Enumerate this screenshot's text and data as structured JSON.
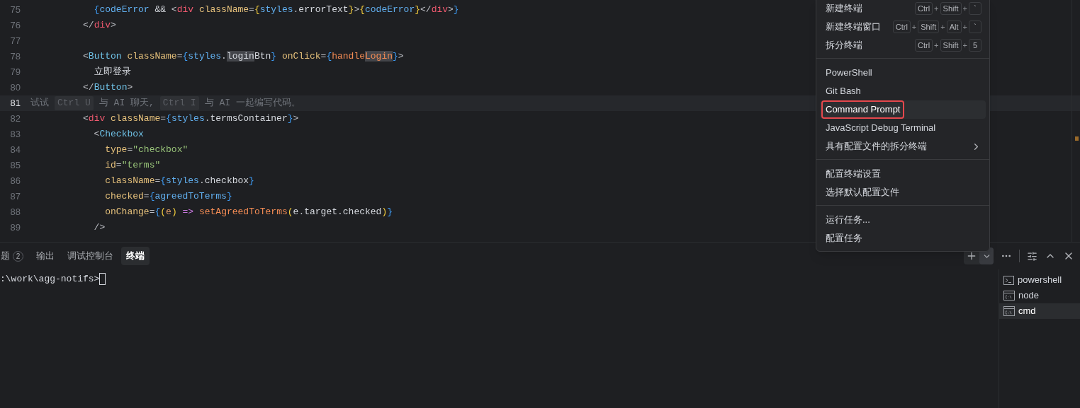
{
  "editor": {
    "lines": [
      {
        "number": "75",
        "current": false,
        "kind": "code",
        "tokens": [
          {
            "kind": "brace",
            "text": "            {"
          },
          {
            "kind": "var",
            "text": "codeError"
          },
          {
            "kind": "text",
            "text": " && "
          },
          {
            "kind": "punct",
            "text": "<"
          },
          {
            "kind": "tag",
            "text": "div"
          },
          {
            "kind": "attr",
            "text": " className"
          },
          {
            "kind": "punct",
            "text": "="
          },
          {
            "kind": "brace2",
            "text": "{"
          },
          {
            "kind": "var",
            "text": "styles"
          },
          {
            "kind": "punct",
            "text": "."
          },
          {
            "kind": "prop",
            "text": "errorText"
          },
          {
            "kind": "brace2",
            "text": "}"
          },
          {
            "kind": "punct",
            "text": ">"
          },
          {
            "kind": "brace2",
            "text": "{"
          },
          {
            "kind": "var",
            "text": "codeError"
          },
          {
            "kind": "brace2",
            "text": "}"
          },
          {
            "kind": "punct",
            "text": "</"
          },
          {
            "kind": "tag",
            "text": "div"
          },
          {
            "kind": "punct",
            "text": ">"
          },
          {
            "kind": "brace",
            "text": "}"
          }
        ]
      },
      {
        "number": "76",
        "current": false,
        "kind": "code",
        "tokens": [
          {
            "kind": "punct",
            "text": "          </"
          },
          {
            "kind": "tag",
            "text": "div"
          },
          {
            "kind": "punct",
            "text": ">"
          }
        ]
      },
      {
        "number": "77",
        "current": false,
        "kind": "code"
      },
      {
        "number": "78",
        "current": false,
        "kind": "code",
        "tokens": [
          {
            "kind": "punct",
            "text": "          <"
          },
          {
            "kind": "component",
            "text": "Button"
          },
          {
            "kind": "attr",
            "text": " className"
          },
          {
            "kind": "punct",
            "text": "="
          },
          {
            "kind": "brace",
            "text": "{"
          },
          {
            "kind": "var",
            "text": "styles"
          },
          {
            "kind": "punct",
            "text": "."
          },
          {
            "kind": "prop",
            "text": "login",
            "highlighted": true
          },
          {
            "kind": "prop",
            "text": "Btn"
          },
          {
            "kind": "brace",
            "text": "}"
          },
          {
            "kind": "attr",
            "text": " onClick"
          },
          {
            "kind": "punct",
            "text": "="
          },
          {
            "kind": "brace",
            "text": "{"
          },
          {
            "kind": "func",
            "text": "handle"
          },
          {
            "kind": "func",
            "text": "Login",
            "highlighted": true
          },
          {
            "kind": "brace",
            "text": "}"
          },
          {
            "kind": "punct",
            "text": ">"
          }
        ]
      },
      {
        "number": "79",
        "current": false,
        "kind": "code",
        "tokens": [
          {
            "kind": "text",
            "text": "            立即登录"
          }
        ]
      },
      {
        "number": "80",
        "current": false,
        "kind": "code",
        "tokens": [
          {
            "kind": "punct",
            "text": "          </"
          },
          {
            "kind": "component",
            "text": "Button"
          },
          {
            "kind": "punct",
            "text": ">"
          }
        ]
      },
      {
        "number": "81",
        "current": true,
        "kind": "hint",
        "tokens": [
          {
            "kind": "text",
            "text": "试试"
          },
          {
            "kind": "key",
            "text": "Ctrl U"
          },
          {
            "kind": "text",
            "text": "与 AI 聊天,"
          },
          {
            "kind": "key",
            "text": "Ctrl I"
          },
          {
            "kind": "text",
            "text": "与 AI 一起编写代码。"
          }
        ]
      },
      {
        "number": "82",
        "current": false,
        "kind": "code",
        "tokens": [
          {
            "kind": "punct",
            "text": "          <"
          },
          {
            "kind": "tag",
            "text": "div"
          },
          {
            "kind": "attr",
            "text": " className"
          },
          {
            "kind": "punct",
            "text": "="
          },
          {
            "kind": "brace",
            "text": "{"
          },
          {
            "kind": "var",
            "text": "styles"
          },
          {
            "kind": "punct",
            "text": "."
          },
          {
            "kind": "prop",
            "text": "termsContainer"
          },
          {
            "kind": "brace",
            "text": "}"
          },
          {
            "kind": "punct",
            "text": ">"
          }
        ]
      },
      {
        "number": "83",
        "current": false,
        "kind": "code",
        "tokens": [
          {
            "kind": "punct",
            "text": "            <"
          },
          {
            "kind": "component",
            "text": "Checkbox"
          }
        ]
      },
      {
        "number": "84",
        "current": false,
        "kind": "code",
        "tokens": [
          {
            "kind": "attr",
            "text": "              type"
          },
          {
            "kind": "punct",
            "text": "="
          },
          {
            "kind": "string",
            "text": "\"checkbox\""
          }
        ]
      },
      {
        "number": "85",
        "current": false,
        "kind": "code",
        "tokens": [
          {
            "kind": "attr",
            "text": "              id"
          },
          {
            "kind": "punct",
            "text": "="
          },
          {
            "kind": "string",
            "text": "\"terms\""
          }
        ]
      },
      {
        "number": "86",
        "current": false,
        "kind": "code",
        "tokens": [
          {
            "kind": "attr",
            "text": "              className"
          },
          {
            "kind": "punct",
            "text": "="
          },
          {
            "kind": "brace",
            "text": "{"
          },
          {
            "kind": "var",
            "text": "styles"
          },
          {
            "kind": "punct",
            "text": "."
          },
          {
            "kind": "prop",
            "text": "checkbox"
          },
          {
            "kind": "brace",
            "text": "}"
          }
        ]
      },
      {
        "number": "87",
        "current": false,
        "kind": "code",
        "tokens": [
          {
            "kind": "attr",
            "text": "              checked"
          },
          {
            "kind": "punct",
            "text": "="
          },
          {
            "kind": "brace",
            "text": "{"
          },
          {
            "kind": "var",
            "text": "agreedToTerms"
          },
          {
            "kind": "brace",
            "text": "}"
          }
        ]
      },
      {
        "number": "88",
        "current": false,
        "kind": "code",
        "tokens": [
          {
            "kind": "attr",
            "text": "              onChange"
          },
          {
            "kind": "punct",
            "text": "="
          },
          {
            "kind": "brace",
            "text": "{"
          },
          {
            "kind": "brace2",
            "text": "("
          },
          {
            "kind": "param",
            "text": "e"
          },
          {
            "kind": "brace2",
            "text": ")"
          },
          {
            "kind": "keyword",
            "text": " => "
          },
          {
            "kind": "func",
            "text": "setAgreedToTerms"
          },
          {
            "kind": "brace2",
            "text": "("
          },
          {
            "kind": "prop",
            "text": "e"
          },
          {
            "kind": "punct",
            "text": "."
          },
          {
            "kind": "prop",
            "text": "target"
          },
          {
            "kind": "punct",
            "text": "."
          },
          {
            "kind": "prop",
            "text": "checked"
          },
          {
            "kind": "brace2",
            "text": ")"
          },
          {
            "kind": "brace",
            "text": "}"
          }
        ]
      },
      {
        "number": "89",
        "current": false,
        "kind": "code",
        "tokens": [
          {
            "kind": "punct",
            "text": "            />"
          }
        ]
      }
    ]
  },
  "menu": {
    "groups": [
      {
        "items": [
          {
            "label": "新建终端",
            "selected": false,
            "submenu": false,
            "keys": [
              "Ctrl",
              "Shift",
              "`"
            ]
          },
          {
            "label": "新建终端窗口",
            "selected": false,
            "submenu": false,
            "keys": [
              "Ctrl",
              "Shift",
              "Alt",
              "`"
            ]
          },
          {
            "label": "拆分终端",
            "selected": false,
            "submenu": false,
            "keys": [
              "Ctrl",
              "Shift",
              "5"
            ]
          }
        ]
      },
      {
        "items": [
          {
            "label": "PowerShell",
            "selected": false,
            "submenu": false
          },
          {
            "label": "Git Bash",
            "selected": false,
            "submenu": false
          },
          {
            "label": "Command Prompt",
            "selected": true,
            "submenu": false
          },
          {
            "label": "JavaScript Debug Terminal",
            "selected": false,
            "submenu": false
          },
          {
            "label": "具有配置文件的拆分终端",
            "selected": false,
            "submenu": true
          }
        ]
      },
      {
        "items": [
          {
            "label": "配置终端设置",
            "selected": false,
            "submenu": false
          },
          {
            "label": "选择默认配置文件",
            "selected": false,
            "submenu": false
          }
        ]
      },
      {
        "items": [
          {
            "label": "运行任务...",
            "selected": false,
            "submenu": false
          },
          {
            "label": "配置任务",
            "selected": false,
            "submenu": false
          }
        ]
      }
    ],
    "key_separator": "+"
  },
  "panel": {
    "tabs": [
      {
        "label": "题",
        "badge": "2",
        "selected": false
      },
      {
        "label": "输出",
        "selected": false
      },
      {
        "label": "调试控制台",
        "selected": false
      },
      {
        "label": "终端",
        "selected": true
      }
    ],
    "terminal": {
      "prompt": ":\\work\\agg-notifs>"
    },
    "sessions": [
      {
        "name": "powershell",
        "kind": "powershell",
        "selected": false
      },
      {
        "name": "node",
        "kind": "cmd",
        "selected": false
      },
      {
        "name": "cmd",
        "kind": "cmd",
        "selected": true
      }
    ]
  }
}
